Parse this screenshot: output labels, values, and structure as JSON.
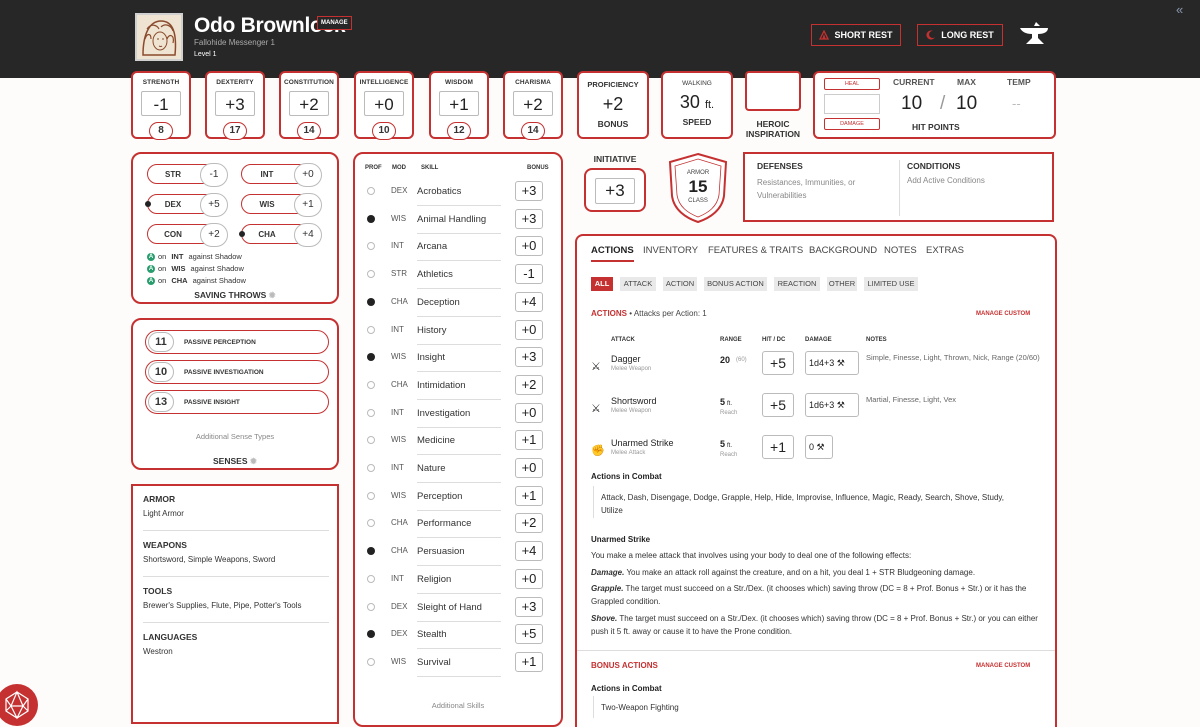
{
  "header": {
    "name": "Odo Brownlock",
    "manage": "MANAGE",
    "subtitle": "Fallohide  Messenger 1",
    "level": "Level 1",
    "short_rest": "SHORT REST",
    "long_rest": "LONG REST"
  },
  "abilities": [
    {
      "name": "STRENGTH",
      "mod": "-1",
      "score": "8"
    },
    {
      "name": "DEXTERITY",
      "mod": "+3",
      "score": "17"
    },
    {
      "name": "CONSTITUTION",
      "mod": "+2",
      "score": "14"
    },
    {
      "name": "INTELLIGENCE",
      "mod": "+0",
      "score": "10"
    },
    {
      "name": "WISDOM",
      "mod": "+1",
      "score": "12"
    },
    {
      "name": "CHARISMA",
      "mod": "+2",
      "score": "14"
    }
  ],
  "proficiency": {
    "title": "PROFICIENCY",
    "value": "+2",
    "label": "BONUS"
  },
  "speed": {
    "title": "WALKING",
    "value": "30",
    "unit": "ft.",
    "label": "SPEED"
  },
  "inspiration": {
    "label1": "HEROIC",
    "label2": "INSPIRATION"
  },
  "hp": {
    "heal": "HEAL",
    "damage": "DAMAGE",
    "current_label": "CURRENT",
    "max_label": "MAX",
    "temp_label": "TEMP",
    "current": "10",
    "max": "10",
    "temp": "--",
    "slash": "/",
    "label": "HIT POINTS"
  },
  "saves": {
    "items": [
      {
        "abbr": "STR",
        "val": "-1",
        "prof": false
      },
      {
        "abbr": "INT",
        "val": "+0",
        "prof": false
      },
      {
        "abbr": "DEX",
        "val": "+5",
        "prof": true
      },
      {
        "abbr": "WIS",
        "val": "+1",
        "prof": false
      },
      {
        "abbr": "CON",
        "val": "+2",
        "prof": false
      },
      {
        "abbr": "CHA",
        "val": "+4",
        "prof": true
      }
    ],
    "adv_on": "on",
    "adv": [
      {
        "stat": "INT",
        "rest": "against Shadow"
      },
      {
        "stat": "WIS",
        "rest": "against Shadow"
      },
      {
        "stat": "CHA",
        "rest": "against Shadow"
      }
    ],
    "adv_letter": "A",
    "title": "SAVING THROWS"
  },
  "senses": {
    "items": [
      {
        "value": "11",
        "label": "PASSIVE PERCEPTION"
      },
      {
        "value": "10",
        "label": "PASSIVE INVESTIGATION"
      },
      {
        "value": "13",
        "label": "PASSIVE INSIGHT"
      }
    ],
    "additional": "Additional Sense Types",
    "title": "SENSES"
  },
  "proficiencies": [
    {
      "title": "ARMOR",
      "text": "Light Armor"
    },
    {
      "title": "WEAPONS",
      "text": "Shortsword, Simple Weapons, Sword"
    },
    {
      "title": "TOOLS",
      "text": "Brewer's Supplies, Flute, Pipe, Potter's Tools"
    },
    {
      "title": "LANGUAGES",
      "text": "Westron"
    }
  ],
  "skills": {
    "headers": {
      "prof": "PROF",
      "mod": "MOD",
      "skill": "SKILL",
      "bonus": "BONUS"
    },
    "items": [
      {
        "mod": "DEX",
        "name": "Acrobatics",
        "bonus": "+3",
        "prof": false
      },
      {
        "mod": "WIS",
        "name": "Animal Handling",
        "bonus": "+3",
        "prof": true
      },
      {
        "mod": "INT",
        "name": "Arcana",
        "bonus": "+0",
        "prof": false
      },
      {
        "mod": "STR",
        "name": "Athletics",
        "bonus": "-1",
        "prof": false
      },
      {
        "mod": "CHA",
        "name": "Deception",
        "bonus": "+4",
        "prof": true
      },
      {
        "mod": "INT",
        "name": "History",
        "bonus": "+0",
        "prof": false
      },
      {
        "mod": "WIS",
        "name": "Insight",
        "bonus": "+3",
        "prof": true
      },
      {
        "mod": "CHA",
        "name": "Intimidation",
        "bonus": "+2",
        "prof": false
      },
      {
        "mod": "INT",
        "name": "Investigation",
        "bonus": "+0",
        "prof": false
      },
      {
        "mod": "WIS",
        "name": "Medicine",
        "bonus": "+1",
        "prof": false
      },
      {
        "mod": "INT",
        "name": "Nature",
        "bonus": "+0",
        "prof": false
      },
      {
        "mod": "WIS",
        "name": "Perception",
        "bonus": "+1",
        "prof": false
      },
      {
        "mod": "CHA",
        "name": "Performance",
        "bonus": "+2",
        "prof": false
      },
      {
        "mod": "CHA",
        "name": "Persuasion",
        "bonus": "+4",
        "prof": true
      },
      {
        "mod": "INT",
        "name": "Religion",
        "bonus": "+0",
        "prof": false
      },
      {
        "mod": "DEX",
        "name": "Sleight of Hand",
        "bonus": "+3",
        "prof": false
      },
      {
        "mod": "DEX",
        "name": "Stealth",
        "bonus": "+5",
        "prof": true
      },
      {
        "mod": "WIS",
        "name": "Survival",
        "bonus": "+1",
        "prof": false
      }
    ],
    "additional": "Additional Skills"
  },
  "initiative": {
    "title": "INITIATIVE",
    "value": "+3"
  },
  "armor": {
    "top": "ARMOR",
    "value": "15",
    "bottom": "CLASS"
  },
  "defenses": {
    "title": "DEFENSES",
    "text": "Resistances, Immunities, or Vulnerabilities"
  },
  "conditions": {
    "title": "CONDITIONS",
    "text": "Add Active Conditions"
  },
  "tabs": [
    "ACTIONS",
    "INVENTORY",
    "FEATURES & TRAITS",
    "BACKGROUND",
    "NOTES",
    "EXTRAS"
  ],
  "filters": [
    "ALL",
    "ATTACK",
    "ACTION",
    "BONUS ACTION",
    "REACTION",
    "OTHER",
    "LIMITED USE"
  ],
  "actions": {
    "title": "ACTIONS",
    "per_action": "• Attacks per Action: 1",
    "manage_custom": "MANAGE CUSTOM",
    "col_attack": "ATTACK",
    "col_range": "RANGE",
    "col_hit": "HIT / DC",
    "col_damage": "DAMAGE",
    "col_notes": "NOTES",
    "attacks": [
      {
        "name": "Dagger",
        "type": "Melee Weapon",
        "range": "20",
        "range_sub": "(60)",
        "hit": "+5",
        "damage": "1d4+3",
        "notes": "Simple, Finesse, Light, Thrown, Nick, Range (20/60)"
      },
      {
        "name": "Shortsword",
        "type": "Melee Weapon",
        "range": "5",
        "range_unit": "ft.",
        "range_sub": "Reach",
        "hit": "+5",
        "damage": "1d6+3",
        "notes": "Martial, Finesse, Light, Vex"
      },
      {
        "name": "Unarmed Strike",
        "type": "Melee Attack",
        "range": "5",
        "range_unit": "ft.",
        "range_sub": "Reach",
        "hit": "+1",
        "damage": "0",
        "notes": ""
      }
    ],
    "combat_title": "Actions in Combat",
    "combat_text": "Attack, Dash, Disengage, Dodge, Grapple, Help, Hide, Improvise, Influence, Magic, Ready, Search, Shove, Study, Utilize",
    "unarmed_title": "Unarmed Strike",
    "unarmed_intro": "You make a melee attack that involves using your body to deal one of the following effects:",
    "damage_label": "Damage.",
    "damage_text": "You make an attack roll against the creature, and on a hit, you deal 1 + STR Bludgeoning damage.",
    "grapple_label": "Grapple.",
    "grapple_text": "The target must succeed on a Str./Dex. (it chooses which) saving throw (DC = 8 + Prof. Bonus + Str.) or it has the Grappled condition.",
    "shove_label": "Shove.",
    "shove_text": "The target must succeed on a Str./Dex. (it chooses which) saving throw (DC = 8 + Prof. Bonus + Str.) or you can either push it 5 ft. away or cause it to have the Prone condition."
  },
  "bonus_actions": {
    "title": "BONUS ACTIONS",
    "manage_custom": "MANAGE CUSTOM",
    "combat_title": "Actions in Combat",
    "item": "Two-Weapon Fighting"
  },
  "colors": {
    "accent": "#c53131",
    "header_bg": "#272727",
    "adv": "#2a9d6f"
  }
}
